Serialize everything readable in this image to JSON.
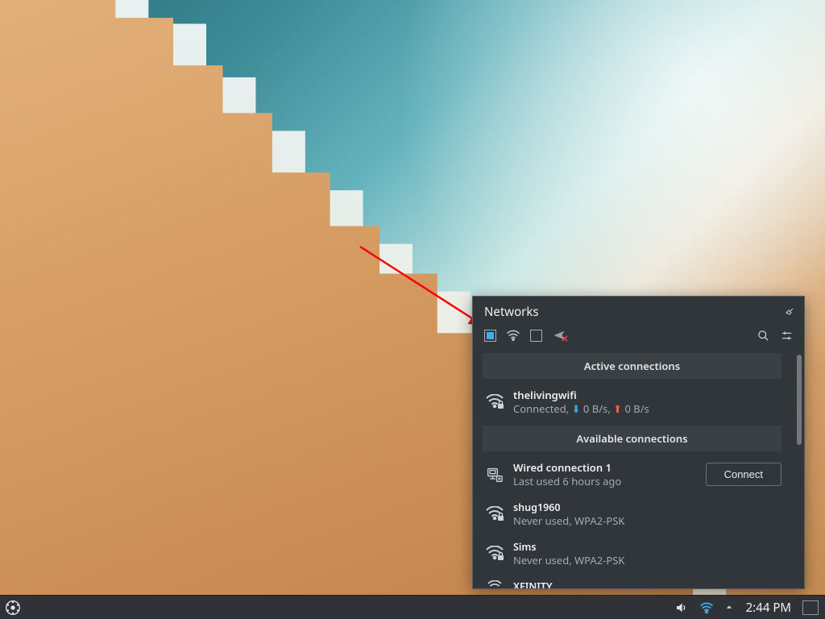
{
  "popup": {
    "title": "Networks",
    "connect_label": "Connect",
    "sections": {
      "active": "Active connections",
      "available": "Available connections"
    },
    "toolbar": {
      "networking_enabled": true,
      "wifi_enabled": true,
      "wired_enabled": false,
      "airplane_mode": false
    },
    "active": {
      "name": "thelivingwifi",
      "status_prefix": "Connected,",
      "down": "0 B/s",
      "up": "0 B/s"
    },
    "available": [
      {
        "name": "Wired connection 1",
        "sub": "Last used 6 hours ago",
        "type": "wired"
      },
      {
        "name": "shug1960",
        "sub": "Never used, WPA2-PSK",
        "type": "wifi-secure"
      },
      {
        "name": "Sims",
        "sub": "Never used, WPA2-PSK",
        "type": "wifi-secure"
      },
      {
        "name": "XFINITY",
        "sub": "",
        "type": "wifi"
      }
    ]
  },
  "taskbar": {
    "clock": "2:44 PM"
  },
  "colors": {
    "accent": "#3daee9",
    "panel": "#31363b",
    "upload": "#e9643a",
    "error": "#da4453"
  }
}
